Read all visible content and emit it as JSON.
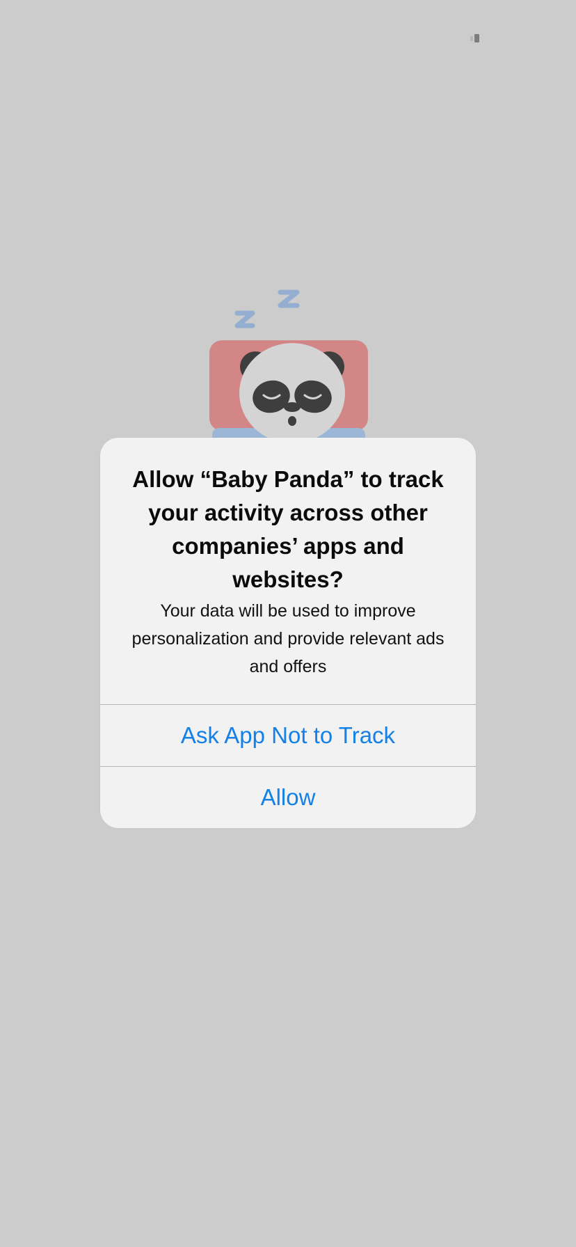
{
  "background": {
    "color": "#cccccc",
    "illustration": "sleeping-panda-icon"
  },
  "status_bar": {
    "icon": "signal-indicator-icon"
  },
  "tracking_alert": {
    "title": "Allow “Baby Panda” to track your activity across other companies’ apps and websites?",
    "message": "Your data will be used to improve personalization and provide relevant ads and offers",
    "buttons": {
      "ask_not_to_track": "Ask App Not to Track",
      "allow": "Allow"
    },
    "accent_color": "#1580e6",
    "surface_color": "#f2f2f2"
  }
}
